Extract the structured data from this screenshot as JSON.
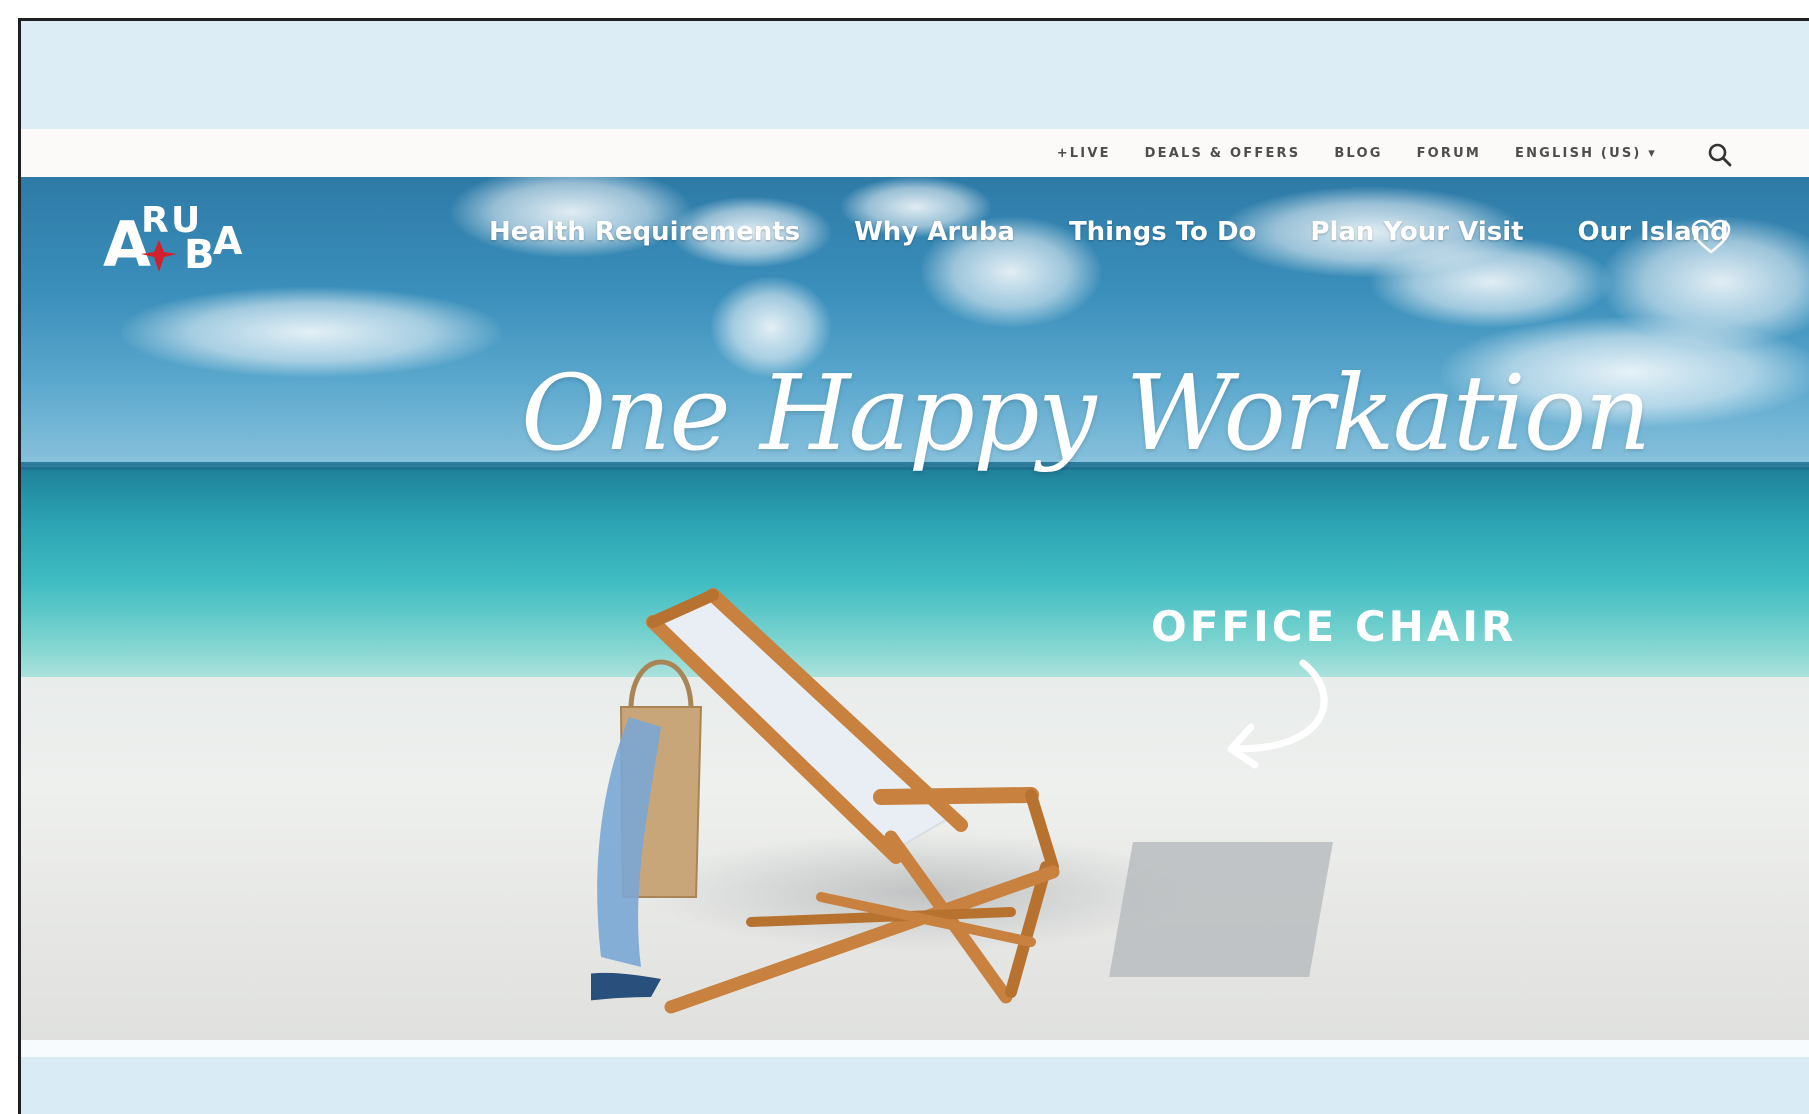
{
  "utility_bar": {
    "links": [
      "+LIVE",
      "DEALS & OFFERS",
      "BLOG",
      "FORUM",
      "ENGLISH (US) ▾"
    ],
    "search_icon": "search-icon"
  },
  "header": {
    "logo_text": "ARUBA",
    "nav": [
      "Health Requirements",
      "Why Aruba",
      "Things To Do",
      "Plan Your Visit",
      "Our Island"
    ],
    "favorites_icon": "heart-icon"
  },
  "hero": {
    "headline": "One Happy Workation",
    "annotation": "OFFICE CHAIR"
  },
  "colors": {
    "page_band": "#dcedf6",
    "utility_bar_bg": "#fbfaf8",
    "nav_text": "#ffffff",
    "logo_red": "#d3202f"
  }
}
